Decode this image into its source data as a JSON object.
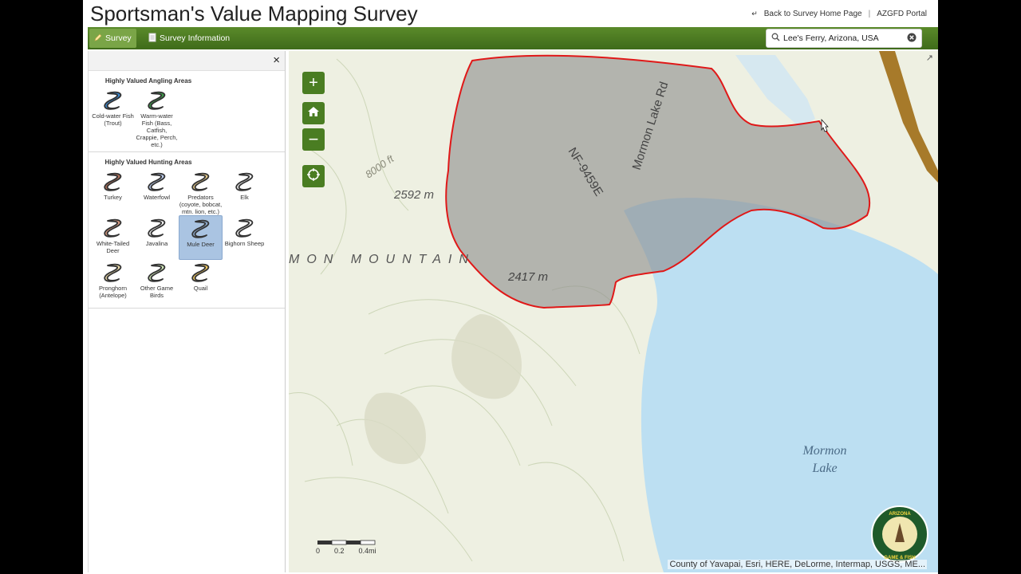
{
  "header": {
    "title": "Sportsman's Value Mapping Survey",
    "links": [
      "Back to Survey Home Page",
      "AZGFD Portal"
    ],
    "link_separator": "|"
  },
  "nav": {
    "tabs": [
      {
        "label": "Survey",
        "icon": "pencil-icon",
        "active": true
      },
      {
        "label": "Survey Information",
        "icon": "document-icon",
        "active": false
      }
    ],
    "search": {
      "value": "Lee's Ferry, Arizona, USA",
      "icon": "search-icon",
      "clear_icon": "clear-icon"
    }
  },
  "panel": {
    "close_label": "×",
    "sections": [
      {
        "title": "Highly Valued Angling Areas",
        "items": [
          {
            "label": "Cold-water Fish (Trout)",
            "color": "#3a87cf",
            "selected": false
          },
          {
            "label": "Warm-water Fish (Bass, Catfish, Crappie, Perch, etc.)",
            "color": "#3e9a4a",
            "selected": false
          }
        ]
      },
      {
        "title": "Highly Valued Hunting Areas",
        "items": [
          {
            "label": "Turkey",
            "color": "#b0705a",
            "selected": false
          },
          {
            "label": "Waterfowl",
            "color": "#b8c8e8",
            "selected": false
          },
          {
            "label": "Predators (coyote, bobcat, mtn. lion, etc.)",
            "color": "#e2c889",
            "selected": false
          },
          {
            "label": "Elk",
            "color": "#f2f2f2",
            "selected": false
          },
          {
            "label": "White-Tailed Deer",
            "color": "#d49880",
            "selected": false
          },
          {
            "label": "Javalina",
            "color": "#f2f2f2",
            "selected": false
          },
          {
            "label": "Mule Deer",
            "color": "#8aa6c8",
            "selected": true
          },
          {
            "label": "Bighorn Sheep",
            "color": "#f2f2f2",
            "selected": false
          },
          {
            "label": "Pronghorn (Antelope)",
            "color": "#e8d8a8",
            "selected": false
          },
          {
            "label": "Other Game Birds",
            "color": "#cfe6b8",
            "selected": false
          },
          {
            "label": "Quail",
            "color": "#f0c860",
            "selected": false
          }
        ]
      }
    ]
  },
  "map": {
    "controls": [
      {
        "name": "zoom-in-button",
        "icon": "plus-icon",
        "glyph": "+"
      },
      {
        "name": "home-button",
        "icon": "home-icon",
        "glyph": ""
      },
      {
        "name": "zoom-out-button",
        "icon": "minus-icon",
        "glyph": "−"
      },
      {
        "name": "locate-button",
        "icon": "locate-icon",
        "glyph": ""
      }
    ],
    "labels": {
      "contour": "8000 ft",
      "elev1": "2592 m",
      "elev2": "2417 m",
      "mountain": "MON MOUNTAIN",
      "road1": "NF-9459E",
      "road2": "Mormon Lake Rd",
      "lake_line1": "Mormon",
      "lake_line2": "Lake"
    },
    "scale": {
      "ticks": [
        "0",
        "0.2",
        "0.4mi"
      ]
    },
    "attribution": "County of Yavapai, Esri, HERE, DeLorme, Intermap, USGS, ME...",
    "logo_text": "ARIZONA GAME & FISH",
    "colors": {
      "water": "#bcdff2",
      "land": "#eef0e2",
      "polygon_outline": "#e01818",
      "polygon_fill": "#8c8c8c"
    }
  }
}
